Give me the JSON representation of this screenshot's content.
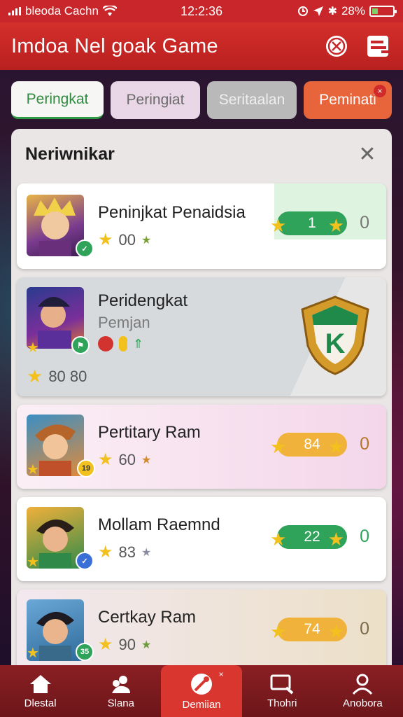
{
  "status": {
    "carrier": "bleoda Cachn",
    "time": "12:2:36",
    "battery": "28%",
    "battery_level": 0.28
  },
  "header": {
    "title": "Imdoa Nel goak Game"
  },
  "tabs": [
    {
      "label": "Peringkat"
    },
    {
      "label": "Peringiat"
    },
    {
      "label": "Seritaalan"
    },
    {
      "label": "Peminati"
    }
  ],
  "panel": {
    "title": "Neriwnikar"
  },
  "rows": [
    {
      "name": "Peninjkat Penaidsia",
      "points": "00",
      "rank": "1",
      "score": "0",
      "rank_color": "#2fa35a",
      "accent": "#e4f7e6"
    },
    {
      "name": "Peridengkat",
      "sub": "Pemjan",
      "points": "80 80",
      "emblem_letter": "K"
    },
    {
      "name": "Pertitary Ram",
      "points": "60",
      "rank": "84",
      "score": "0",
      "rank_color": "#f0b23a",
      "badge": "19"
    },
    {
      "name": "Mollam Raemnd",
      "points": "83",
      "rank": "22",
      "score": "0",
      "rank_color": "#2fa35a"
    },
    {
      "name": "Certkay Ram",
      "points": "90",
      "rank": "74",
      "score": "0",
      "rank_color": "#f0b23a",
      "badge": "35"
    }
  ],
  "nav": [
    {
      "label": "Dlestal",
      "icon": "home-icon"
    },
    {
      "label": "Slana",
      "icon": "users-icon"
    },
    {
      "label": "Demiian",
      "icon": "game-icon",
      "active": true
    },
    {
      "label": "Thohri",
      "icon": "screen-icon"
    },
    {
      "label": "Anobora",
      "icon": "profile-icon"
    }
  ]
}
